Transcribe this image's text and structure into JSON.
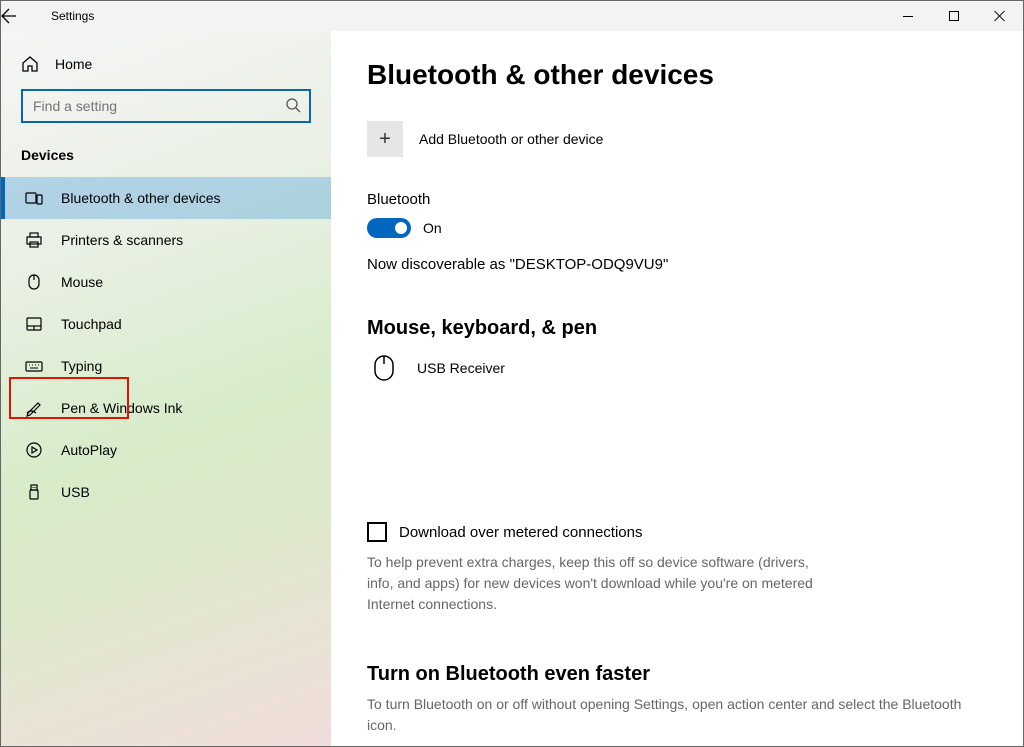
{
  "titlebar": {
    "title": "Settings"
  },
  "sidebar": {
    "home": "Home",
    "search_placeholder": "Find a setting",
    "category": "Devices",
    "items": [
      {
        "label": "Bluetooth & other devices",
        "icon": "bluetooth-devices-icon",
        "selected": true
      },
      {
        "label": "Printers & scanners",
        "icon": "printer-icon",
        "selected": false
      },
      {
        "label": "Mouse",
        "icon": "mouse-icon",
        "selected": false
      },
      {
        "label": "Touchpad",
        "icon": "touchpad-icon",
        "selected": false,
        "highlighted": true
      },
      {
        "label": "Typing",
        "icon": "keyboard-icon",
        "selected": false
      },
      {
        "label": "Pen & Windows Ink",
        "icon": "pen-icon",
        "selected": false
      },
      {
        "label": "AutoPlay",
        "icon": "autoplay-icon",
        "selected": false
      },
      {
        "label": "USB",
        "icon": "usb-icon",
        "selected": false
      }
    ]
  },
  "main": {
    "title": "Bluetooth & other devices",
    "add_device_label": "Add Bluetooth or other device",
    "bluetooth": {
      "label": "Bluetooth",
      "state": "On"
    },
    "discoverable": "Now discoverable as \"DESKTOP-ODQ9VU9\"",
    "devices_section": {
      "title": "Mouse, keyboard, & pen",
      "items": [
        {
          "name": "USB Receiver"
        }
      ]
    },
    "metered": {
      "label": "Download over metered connections",
      "help": "To help prevent extra charges, keep this off so device software (drivers, info, and apps) for new devices won't download while you're on metered Internet connections."
    },
    "faster": {
      "title": "Turn on Bluetooth even faster",
      "help": "To turn Bluetooth on or off without opening Settings, open action center and select the Bluetooth icon."
    }
  }
}
